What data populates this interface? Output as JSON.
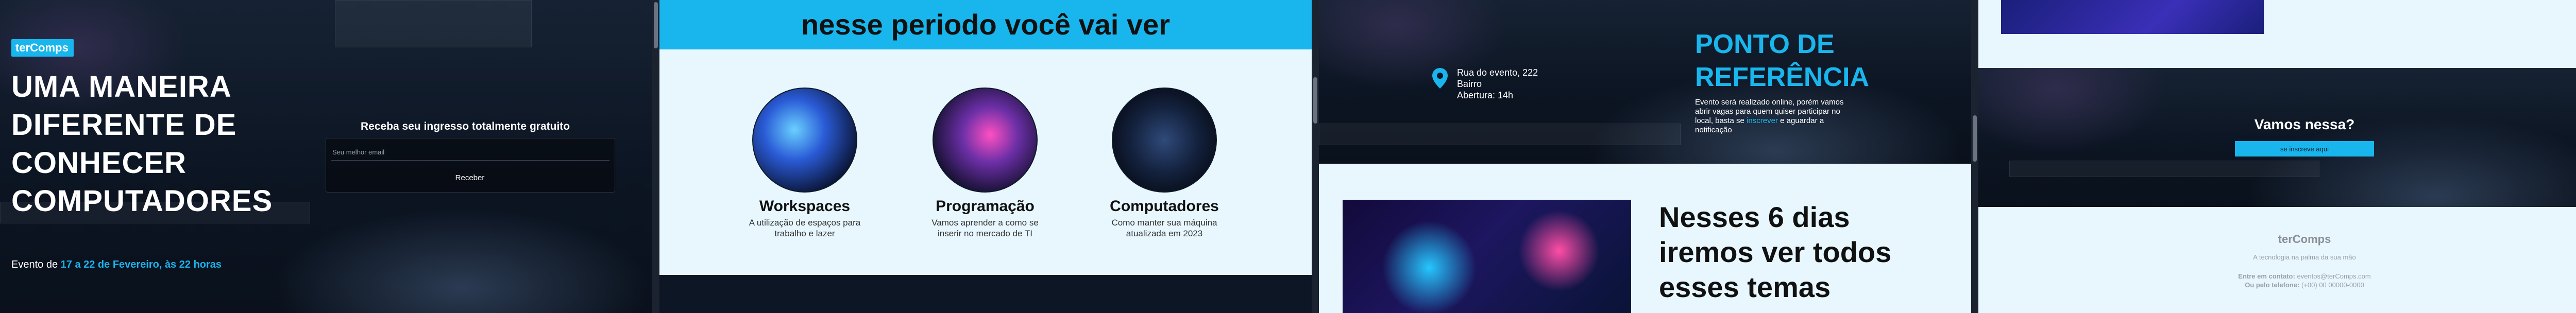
{
  "colors": {
    "accent": "#19b6ee",
    "light_bg": "#e7f7fd",
    "dark_bg": "#0c1523"
  },
  "panel1": {
    "logo": "terComps",
    "hero_title": "UMA MANEIRA DIFERENTE DE CONHECER COMPUTADORES",
    "event_prefix": "Evento de",
    "event_dates": "17 a 22 de Fevereiro, às 22 horas",
    "signup_title": "Receba seu ingresso totalmente gratuito",
    "email_placeholder": "Seu melhor email",
    "submit_label": "Receber"
  },
  "panel2": {
    "band_title": "nesse periodo você vai ver",
    "features": [
      {
        "title": "Workspaces",
        "desc": "A utilização de espaços para trabalho e lazer",
        "icon": "workspace-photo"
      },
      {
        "title": "Programação",
        "desc": "Vamos aprender a como se inserir no mercado de TI",
        "icon": "programming-photo"
      },
      {
        "title": "Computadores",
        "desc": "Como manter sua máquina atualizada em 2023",
        "icon": "keyboard-photo"
      }
    ]
  },
  "panel3": {
    "address": [
      "Rua do evento, 222",
      "Bairro",
      "Abertura: 14h"
    ],
    "ref_title": "PONTO DE REFERÊNCIA",
    "ref_desc_before": "Evento será realizado online, porém vamos abrir vagas para quem quiser participar no local, basta se",
    "ref_desc_link": "inscrever",
    "ref_desc_after": "e aguardar a notificação",
    "themes_title": "Nesses 6 dias iremos ver todos esses temas"
  },
  "panel4": {
    "cta_title": "Vamos nessa?",
    "cta_button": "se inscreve aqui",
    "footer_brand": "terComps",
    "footer_tagline": "A tecnologia na palma da sua mão",
    "footer_contact_label": "Entre em contato:",
    "footer_contact_email": "eventos@terComps.com",
    "footer_phone_label": "Ou pelo telefone:",
    "footer_phone": "(+00) 00 00000-0000"
  }
}
